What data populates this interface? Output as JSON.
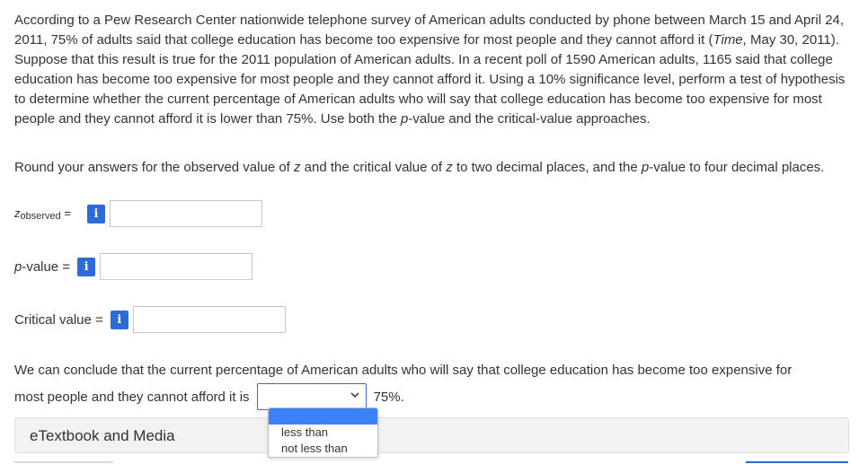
{
  "question": {
    "p1_a": "According to a Pew Research Center nationwide telephone survey of American adults conducted by phone between March 15 and April 24, 2011, 75% of adults said that college education has become too expensive for most people and they cannot afford it (",
    "p1_italic": "Time",
    "p1_b": ", May 30, 2011). Suppose that this result is true for the 2011 population of American adults. In a recent poll of 1590 American adults, 1165 said that college education has become too expensive for most people and they cannot afford it. Using a 10% significance level, perform a test of hypothesis to determine whether the current percentage of American adults who will say that college education has become too expensive for most people and they cannot afford it is lower than 75%. Use both the ",
    "p1_p": "p",
    "p1_c": "-value and the critical-value approaches.",
    "round_a": "Round your answers for the observed value of ",
    "round_z1": "z",
    "round_b": " and the critical value of ",
    "round_z2": "z",
    "round_c": " to two decimal places, and the ",
    "round_p": "p",
    "round_d": "-value to four decimal places."
  },
  "fields": {
    "z_label": "z",
    "z_sub": "observed",
    "z_eq": " =",
    "z_value": "",
    "p_label_p": "p",
    "p_label_rest": "-value =",
    "p_value": "",
    "crit_label": "Critical value =",
    "crit_value": "",
    "info_glyph": "i"
  },
  "conclusion": {
    "line1": "We can conclude that the current percentage of American adults who will say that college education has become too expensive for",
    "line2_before": "most people and they cannot afford it is",
    "line2_after": "75%.",
    "selected": "",
    "options": [
      "less than",
      "not less than"
    ]
  },
  "etextbook": {
    "label": "eTextbook and Media"
  },
  "colors": {
    "accent": "#2f6ad9",
    "highlight": "#3b82f6"
  }
}
